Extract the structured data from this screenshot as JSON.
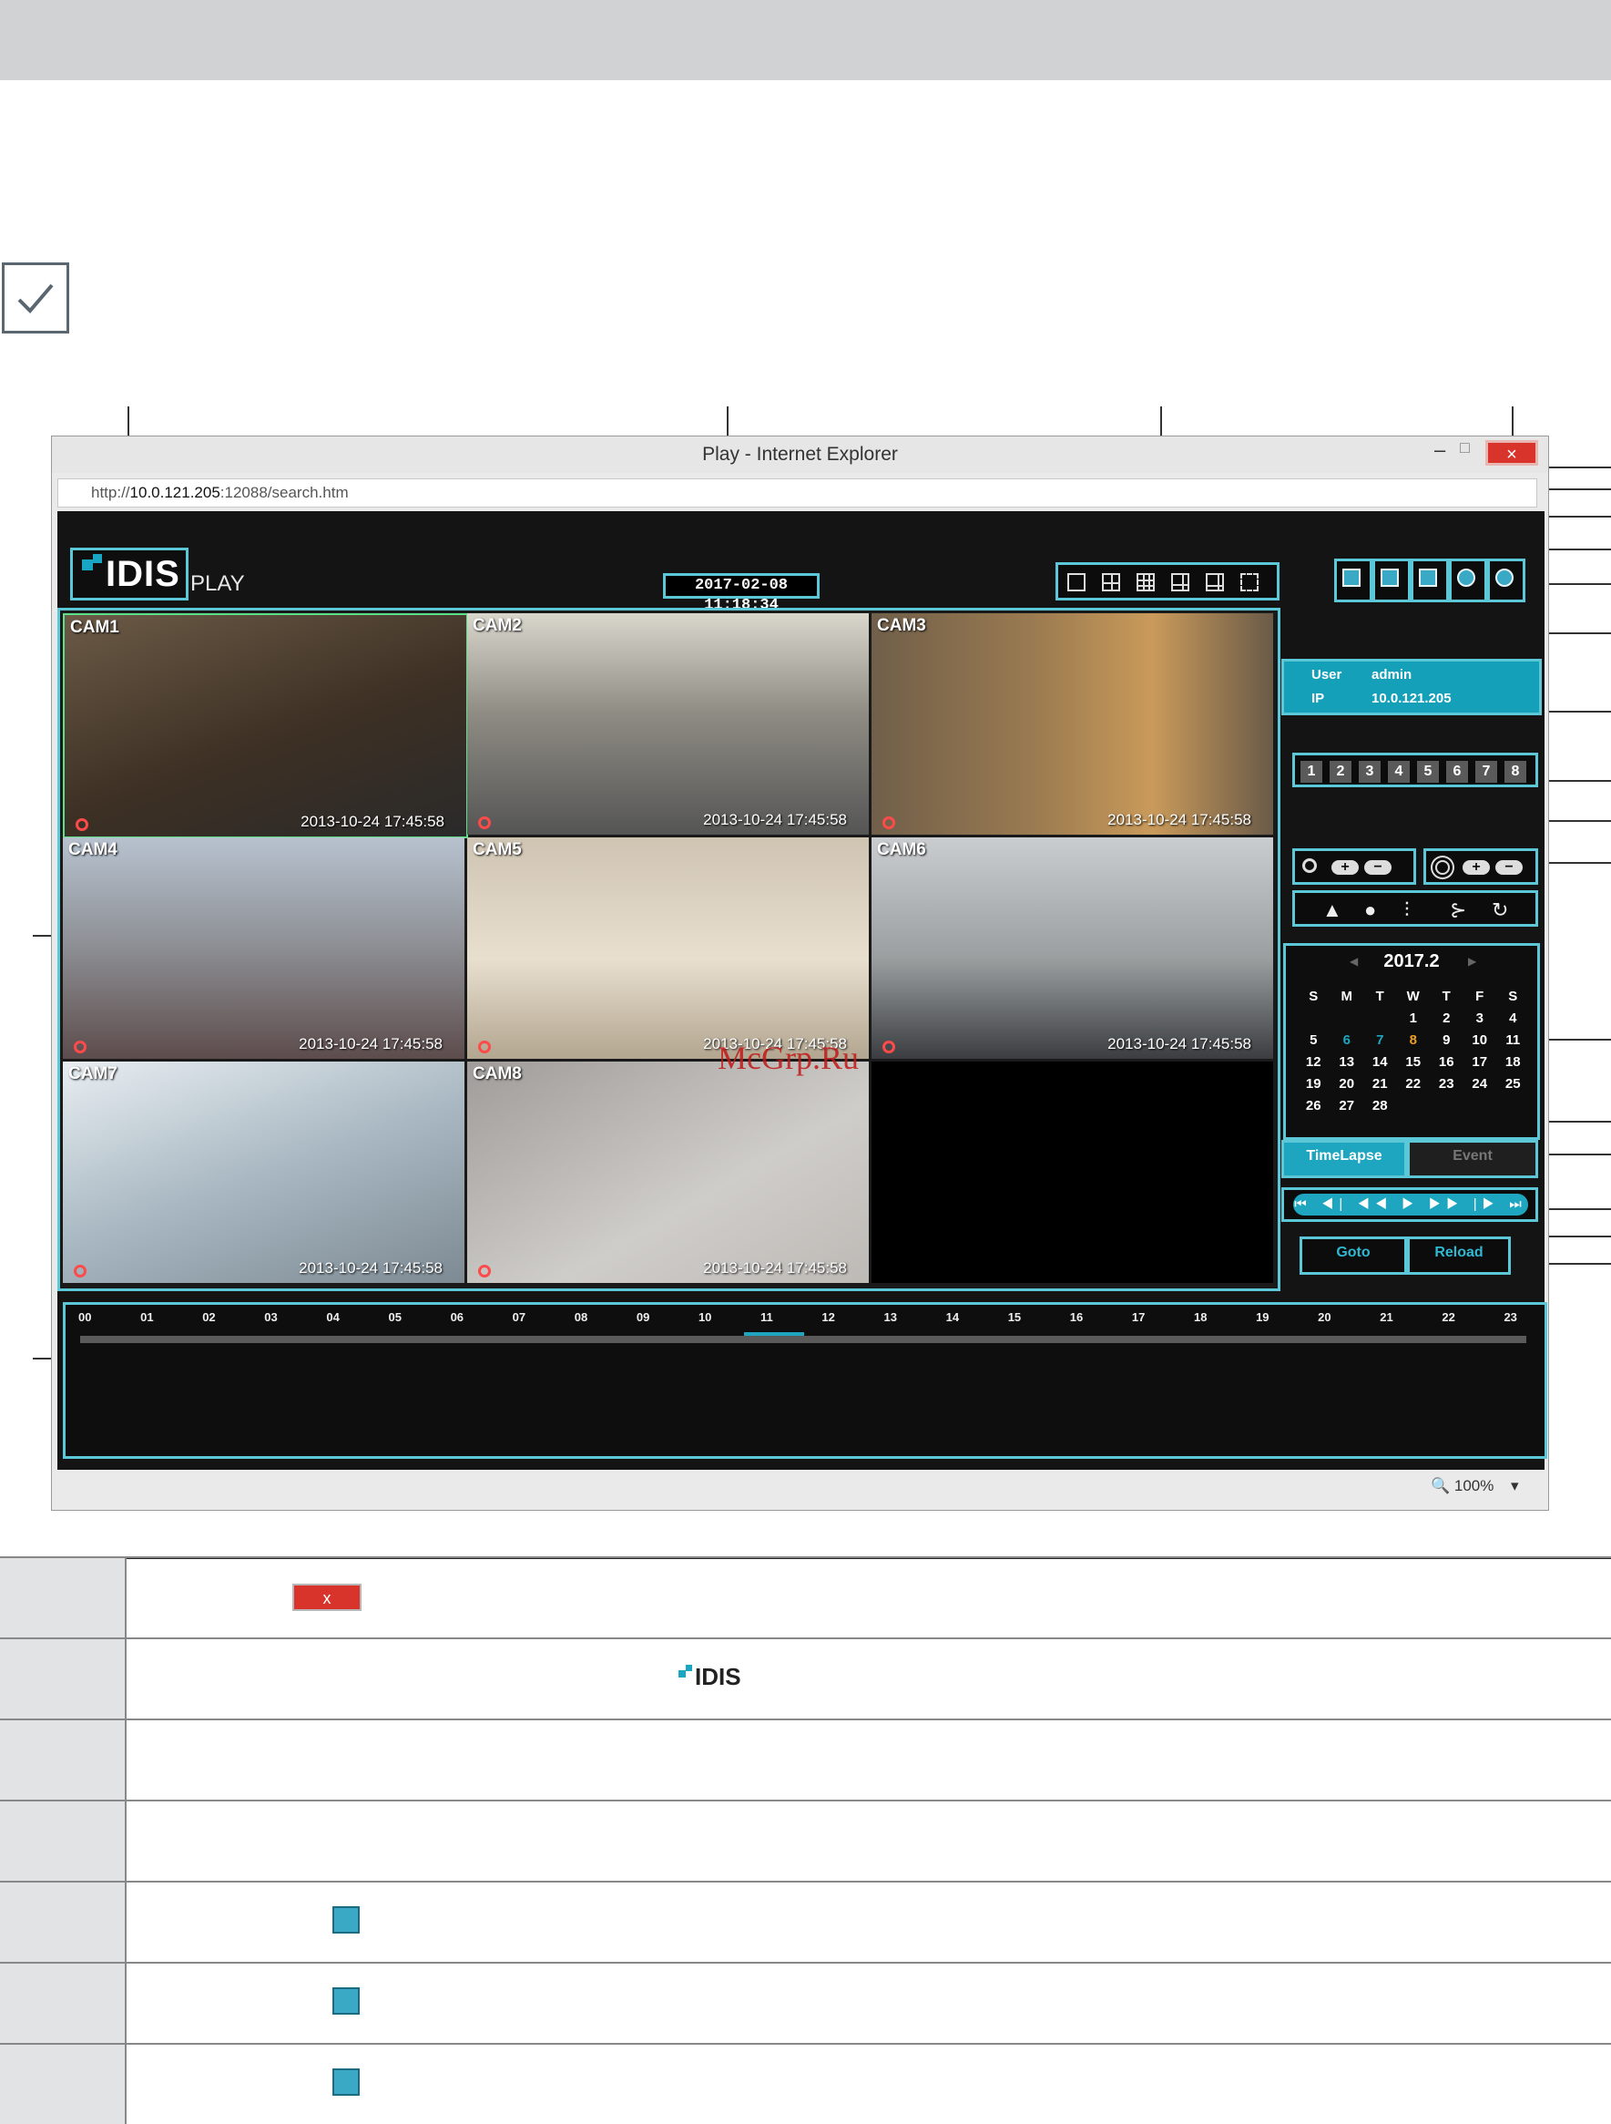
{
  "window": {
    "title": "Play - Internet Explorer",
    "close_symbol": "×",
    "min_symbol": "–",
    "max_symbol": "□",
    "url_prefix": "http://",
    "url_host": "10.0.121.205",
    "url_rest": ":12088/search.htm",
    "status_zoom": "🔍 100%",
    "status_arrow": "▾"
  },
  "app": {
    "logo_text": "IDIS",
    "play_label": "PLAY",
    "datetime": "2017-02-08 11:18:34",
    "user_label": "User",
    "user_value": "admin",
    "ip_label": "IP",
    "ip_value": "10.0.121.205",
    "channels": [
      "1",
      "2",
      "3",
      "4",
      "5",
      "6",
      "7",
      "8"
    ],
    "zoom_plus": "+",
    "zoom_minus": "−",
    "zoom_icon": "search-icon",
    "brightness_icon": "sun-icon",
    "adjust_icons": [
      "▲",
      "●",
      "⫶",
      "⊱",
      "↻"
    ],
    "calendar": {
      "prev": "◀",
      "next": "▶",
      "month": "2017.2",
      "weekdays": [
        "S",
        "M",
        "T",
        "W",
        "T",
        "F",
        "S"
      ],
      "weeks": [
        [
          "",
          "",
          "",
          "1",
          "2",
          "3",
          "4"
        ],
        [
          "5",
          "6",
          "7",
          "8",
          "9",
          "10",
          "11"
        ],
        [
          "12",
          "13",
          "14",
          "15",
          "16",
          "17",
          "18"
        ],
        [
          "19",
          "20",
          "21",
          "22",
          "23",
          "24",
          "25"
        ],
        [
          "26",
          "27",
          "28",
          "",
          "",
          "",
          ""
        ]
      ],
      "highlight_color": "#1ea6c0",
      "today_color": "#f0a020"
    },
    "mode_timelapse": "TimeLapse",
    "mode_event": "Event",
    "transport": "⏮ ◀| ◀◀ ▶ ▶▶ |▶ ⏭",
    "goto_label": "Goto",
    "reload_label": "Reload",
    "cameras": [
      {
        "label": "CAM1",
        "timestamp": "2013-10-24 17:45:58"
      },
      {
        "label": "CAM2",
        "timestamp": "2013-10-24 17:45:58"
      },
      {
        "label": "CAM3",
        "timestamp": "2013-10-24 17:45:58"
      },
      {
        "label": "CAM4",
        "timestamp": "2013-10-24 17:45:58"
      },
      {
        "label": "CAM5",
        "timestamp": "2013-10-24 17:45:58"
      },
      {
        "label": "CAM6",
        "timestamp": "2013-10-24 17:45:58"
      },
      {
        "label": "CAM7",
        "timestamp": "2013-10-24 17:45:58"
      },
      {
        "label": "CAM8",
        "timestamp": "2013-10-24 17:45:58"
      }
    ],
    "timeline_hours": [
      "00",
      "01",
      "02",
      "03",
      "04",
      "05",
      "06",
      "07",
      "08",
      "09",
      "10",
      "11",
      "12",
      "13",
      "14",
      "15",
      "16",
      "17",
      "18",
      "19",
      "20",
      "21",
      "22",
      "23"
    ]
  },
  "watermark": "McGrp.Ru",
  "spec_table": {
    "close_button_symbol": "x",
    "logo_text": "IDIS"
  },
  "colors": {
    "accent": "#5cc7d6",
    "brand_blue": "#19a5c4",
    "close_red": "#d9342b"
  }
}
